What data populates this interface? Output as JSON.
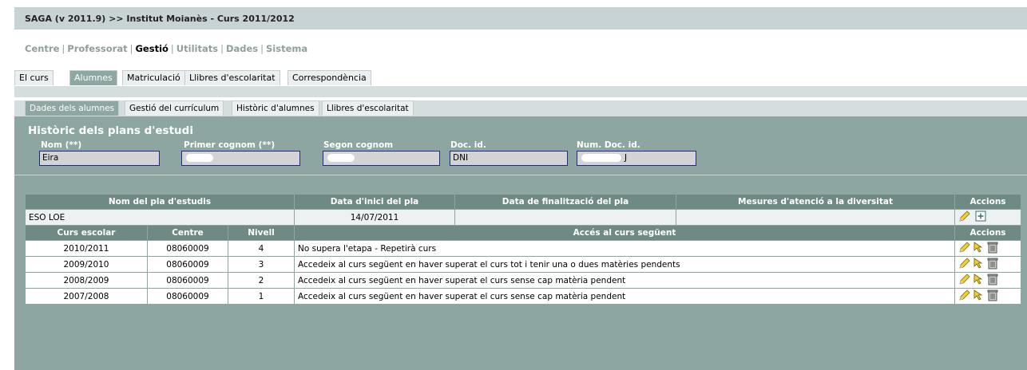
{
  "window": {
    "title": "SAGA (v 2011.9) >> Institut Moianès - Curs 2011/2012"
  },
  "menu": {
    "items": [
      "Centre",
      "Professorat",
      "Gestió",
      "Utilitats",
      "Dades",
      "Sistema"
    ],
    "active": "Gestió"
  },
  "tabs": [
    "El curs",
    "Alumnes",
    "Matriculació",
    "Llibres d'escolaritat",
    "Correspondència"
  ],
  "subtabs": [
    "Dades dels alumnes",
    "Gestió del currículum",
    "Històric d'alumnes",
    "Llibres d'escolaritat"
  ],
  "page": {
    "title": "Històric dels plans d'estudi"
  },
  "fields": {
    "nom": {
      "label": "Nom (**)",
      "value": "Eira"
    },
    "primer_cognom": {
      "label": "Primer cognom (**)",
      "value": ""
    },
    "segon_cognom": {
      "label": "Segon cognom",
      "value": ""
    },
    "doc_id": {
      "label": "Doc. id.",
      "value": "DNI"
    },
    "num_doc_id": {
      "label": "Num. Doc. id.",
      "value": "J"
    }
  },
  "plan_table": {
    "headers": [
      "Nom del pla d'estudis",
      "Data d'inici del pla",
      "Data de finalització del pla",
      "Mesures d'atenció a la diversitat",
      "Accions"
    ],
    "row": {
      "nom": "ESO LOE",
      "inici": "14/07/2011",
      "fi": "",
      "mesures": ""
    }
  },
  "course_table": {
    "headers": [
      "Curs escolar",
      "Centre",
      "Nivell",
      "Accés al curs següent",
      "Accions"
    ],
    "rows": [
      {
        "curs": "2010/2011",
        "centre": "08060009",
        "nivell": "4",
        "acces": "No supera l'etapa - Repetirà curs"
      },
      {
        "curs": "2009/2010",
        "centre": "08060009",
        "nivell": "3",
        "acces": "Accedeix al curs següent en haver superat el curs tot i tenir una o dues matèries pendents"
      },
      {
        "curs": "2008/2009",
        "centre": "08060009",
        "nivell": "2",
        "acces": "Accedeix al curs següent en haver superat el curs sense cap matèria pendent"
      },
      {
        "curs": "2007/2008",
        "centre": "08060009",
        "nivell": "1",
        "acces": "Accedeix al curs següent en haver superat el curs sense cap matèria pendent"
      }
    ]
  },
  "colors": {
    "panel": "#8ea6a1",
    "header_dark": "#6f8a85",
    "header_light": "#b0b9b8",
    "input_border": "#23288c"
  },
  "icons": [
    "pencil-icon",
    "add-icon",
    "arrow-cursor-icon",
    "trash-icon"
  ]
}
